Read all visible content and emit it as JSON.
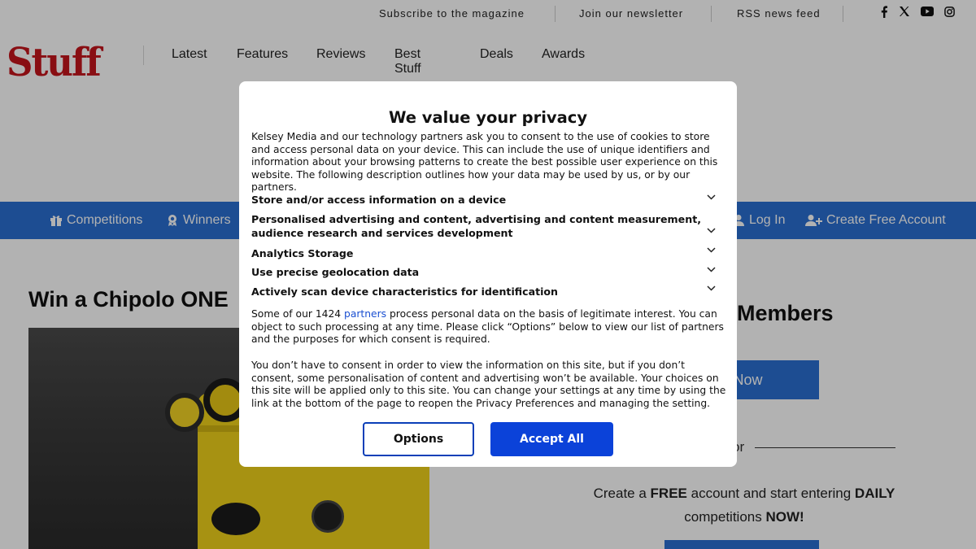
{
  "topbar": {
    "subscribe": "Subscribe to the magazine",
    "newsletter": "Join our newsletter",
    "rss": "RSS news feed",
    "social_icons": [
      "facebook-icon",
      "x-icon",
      "youtube-icon",
      "instagram-icon"
    ]
  },
  "logo": {
    "text": "Stuff",
    "color": "#c4151c"
  },
  "mainnav": [
    "Latest",
    "Features",
    "Reviews",
    "Best Stuff",
    "Deals",
    "Awards"
  ],
  "bluebar": {
    "color": "#2a6fd1",
    "competitions": "Competitions",
    "winners": "Winners",
    "login": "Log In",
    "create_account": "Create Free Account"
  },
  "article": {
    "title": "Win a Chipolo ONE"
  },
  "members": {
    "title": "Members",
    "join_button": "n Now",
    "or": "or",
    "cta_prefix": "Create a ",
    "cta_free": "FREE",
    "cta_middle": " account and start entering ",
    "cta_daily": "DAILY",
    "cta_line2": "competitions ",
    "cta_now": "NOW!"
  },
  "consent": {
    "title": "We value your privacy",
    "intro": "Kelsey Media and our technology partners ask you to consent to the use of cookies to store and access personal data on your device. This can include the use of unique identifiers and information about your browsing patterns to create the best possible user experience on this website. The following description outlines how your data may be used by us, or by our partners.",
    "purposes": [
      "Store and/or access information on a device",
      "Personalised advertising and content, advertising and content measurement, audience research and services development",
      "Analytics Storage",
      "Use precise geolocation data",
      "Actively scan device characteristics for identification"
    ],
    "legit_prefix": "Some of our 1424 ",
    "legit_link": "partners",
    "legit_suffix": " process personal data on the basis of legitimate interest. You can object to such processing at any time. Please click “Options” below to view our list of partners and the purposes for which consent is required.",
    "no_consent": "You don’t have to consent in order to view the information on this site, but if you don’t consent, some personalisation of content and advertising won’t be available. Your choices on this site will be applied only to this site. You can change your settings at any time by using the link at the bottom of the page to reopen the Privacy Preferences and managing the setting.",
    "options_button": "Options",
    "accept_button": "Accept All",
    "accent_color": "#0b42d9"
  }
}
